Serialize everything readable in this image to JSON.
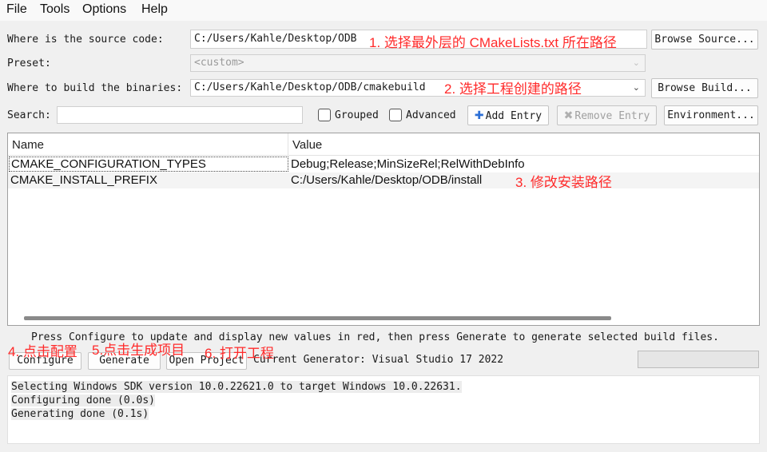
{
  "menu": [
    "File",
    "Tools",
    "Options",
    "Help"
  ],
  "source": {
    "label": "Where is the source code:",
    "value": "C:/Users/Kahle/Desktop/ODB",
    "button": "Browse Source..."
  },
  "preset": {
    "label": "Preset:",
    "value": "<custom>"
  },
  "build": {
    "label": "Where to build the binaries:",
    "value": "C:/Users/Kahle/Desktop/ODB/cmakebuild",
    "button": "Browse Build..."
  },
  "search": {
    "label": "Search:",
    "value": "",
    "grouped": "Grouped",
    "grouped_checked": false,
    "advanced": "Advanced",
    "advanced_checked": false,
    "add_entry": "Add Entry",
    "remove_entry": "Remove Entry",
    "environment": "Environment..."
  },
  "table": {
    "columns": [
      "Name",
      "Value"
    ],
    "rows": [
      {
        "name": "CMAKE_CONFIGURATION_TYPES",
        "value": "Debug;Release;MinSizeRel;RelWithDebInfo"
      },
      {
        "name": "CMAKE_INSTALL_PREFIX",
        "value": "C:/Users/Kahle/Desktop/ODB/install"
      }
    ]
  },
  "hint": "Press Configure to update and display new values in red, then press Generate to generate selected build files.",
  "buttons": {
    "configure": "Configure",
    "generate": "Generate",
    "open_project": "Open Project"
  },
  "generator": "Current Generator: Visual Studio 17 2022",
  "progress": 0,
  "log": [
    "Selecting Windows SDK version 10.0.22621.0 to target Windows 10.0.22631.",
    "Configuring done (0.0s)",
    "Generating done (0.1s)"
  ],
  "annotations": {
    "a1": "1. 选择最外层的 CMakeLists.txt 所在路径",
    "a2": "2. 选择工程创建的路径",
    "a3": "3. 修改安装路径",
    "a4": "4. 点击配置",
    "a5": "5.点击生成项目",
    "a6": "6. 打开工程"
  },
  "colors": {
    "annotation": "#ff2a2a",
    "window_bg": "#f0f0f0"
  },
  "icons": {
    "add": "plus-icon",
    "remove": "x-icon",
    "dropdown": "chevron-down-icon"
  }
}
